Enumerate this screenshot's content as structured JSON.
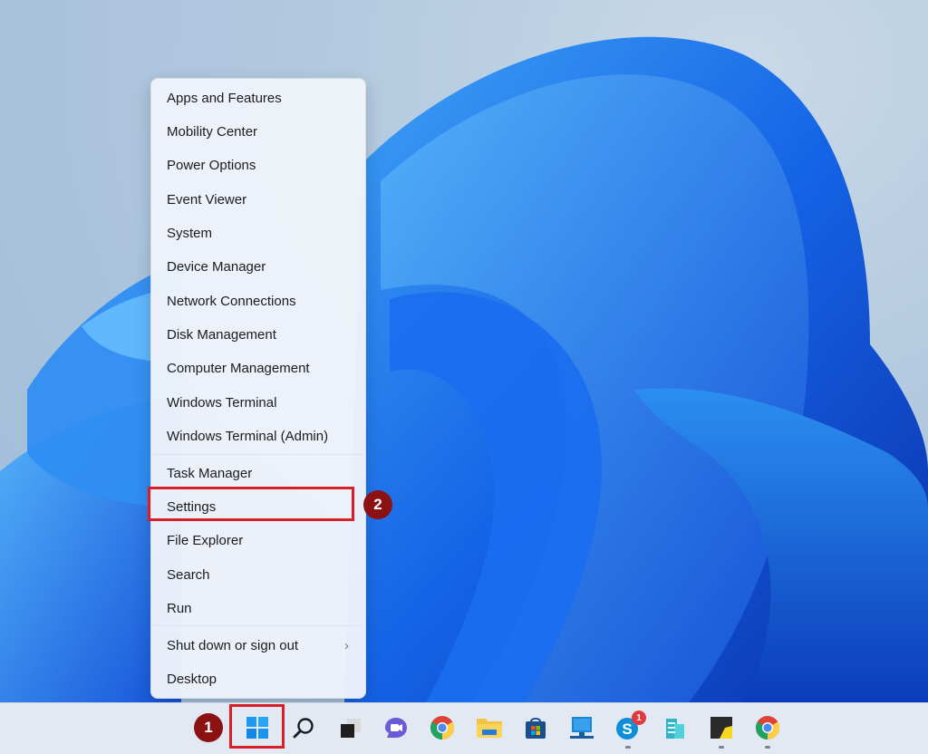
{
  "context_menu": {
    "items": [
      {
        "label": "Apps and Features"
      },
      {
        "label": "Mobility Center"
      },
      {
        "label": "Power Options"
      },
      {
        "label": "Event Viewer"
      },
      {
        "label": "System"
      },
      {
        "label": "Device Manager"
      },
      {
        "label": "Network Connections"
      },
      {
        "label": "Disk Management"
      },
      {
        "label": "Computer Management"
      },
      {
        "label": "Windows Terminal"
      },
      {
        "label": "Windows Terminal (Admin)"
      },
      {
        "label": "Task Manager"
      },
      {
        "label": "Settings",
        "highlighted": true
      },
      {
        "label": "File Explorer"
      },
      {
        "label": "Search"
      },
      {
        "label": "Run"
      },
      {
        "label": "Shut down or sign out",
        "submenu": true
      },
      {
        "label": "Desktop"
      }
    ],
    "submenu_glyph": "›"
  },
  "annotations": {
    "step1": "1",
    "step2": "2",
    "highlight_color": "#d81e27",
    "badge_color": "#8b1113"
  },
  "taskbar": {
    "icons": [
      {
        "name": "start-icon"
      },
      {
        "name": "search-icon"
      },
      {
        "name": "task-view-icon"
      },
      {
        "name": "teams-chat-icon"
      },
      {
        "name": "chrome-icon"
      },
      {
        "name": "file-explorer-icon"
      },
      {
        "name": "microsoft-store-icon"
      },
      {
        "name": "remote-desktop-icon"
      },
      {
        "name": "skype-icon",
        "notification_count": "1",
        "running": true
      },
      {
        "name": "azure-data-studio-icon"
      },
      {
        "name": "sticky-notes-icon",
        "running": true
      },
      {
        "name": "chrome-icon-2",
        "running": true
      }
    ]
  }
}
